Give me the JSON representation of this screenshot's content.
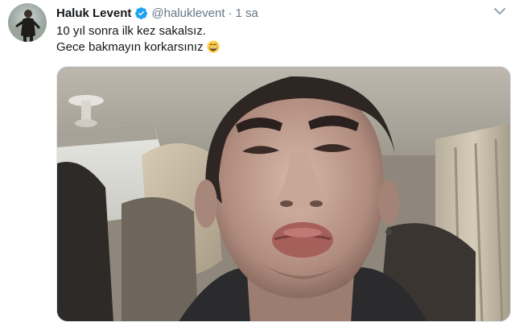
{
  "tweet": {
    "display_name": "Haluk Levent",
    "handle": "@haluklevent",
    "separator": "·",
    "time": "1 sa",
    "text_line1": "10 yıl sonra ilk kez sakalsız.",
    "text_line2": "Gece bakmayın korkarsınız",
    "emoji": "grinning-face-with-smiling-eyes",
    "verified_color": "#1da1f2",
    "media_alt": ""
  },
  "icons": {
    "verified": "verified-badge-icon",
    "caret": "chevron-down-icon"
  },
  "colors": {
    "name": "#14171a",
    "muted": "#657786",
    "border": "#e1e8ed"
  }
}
